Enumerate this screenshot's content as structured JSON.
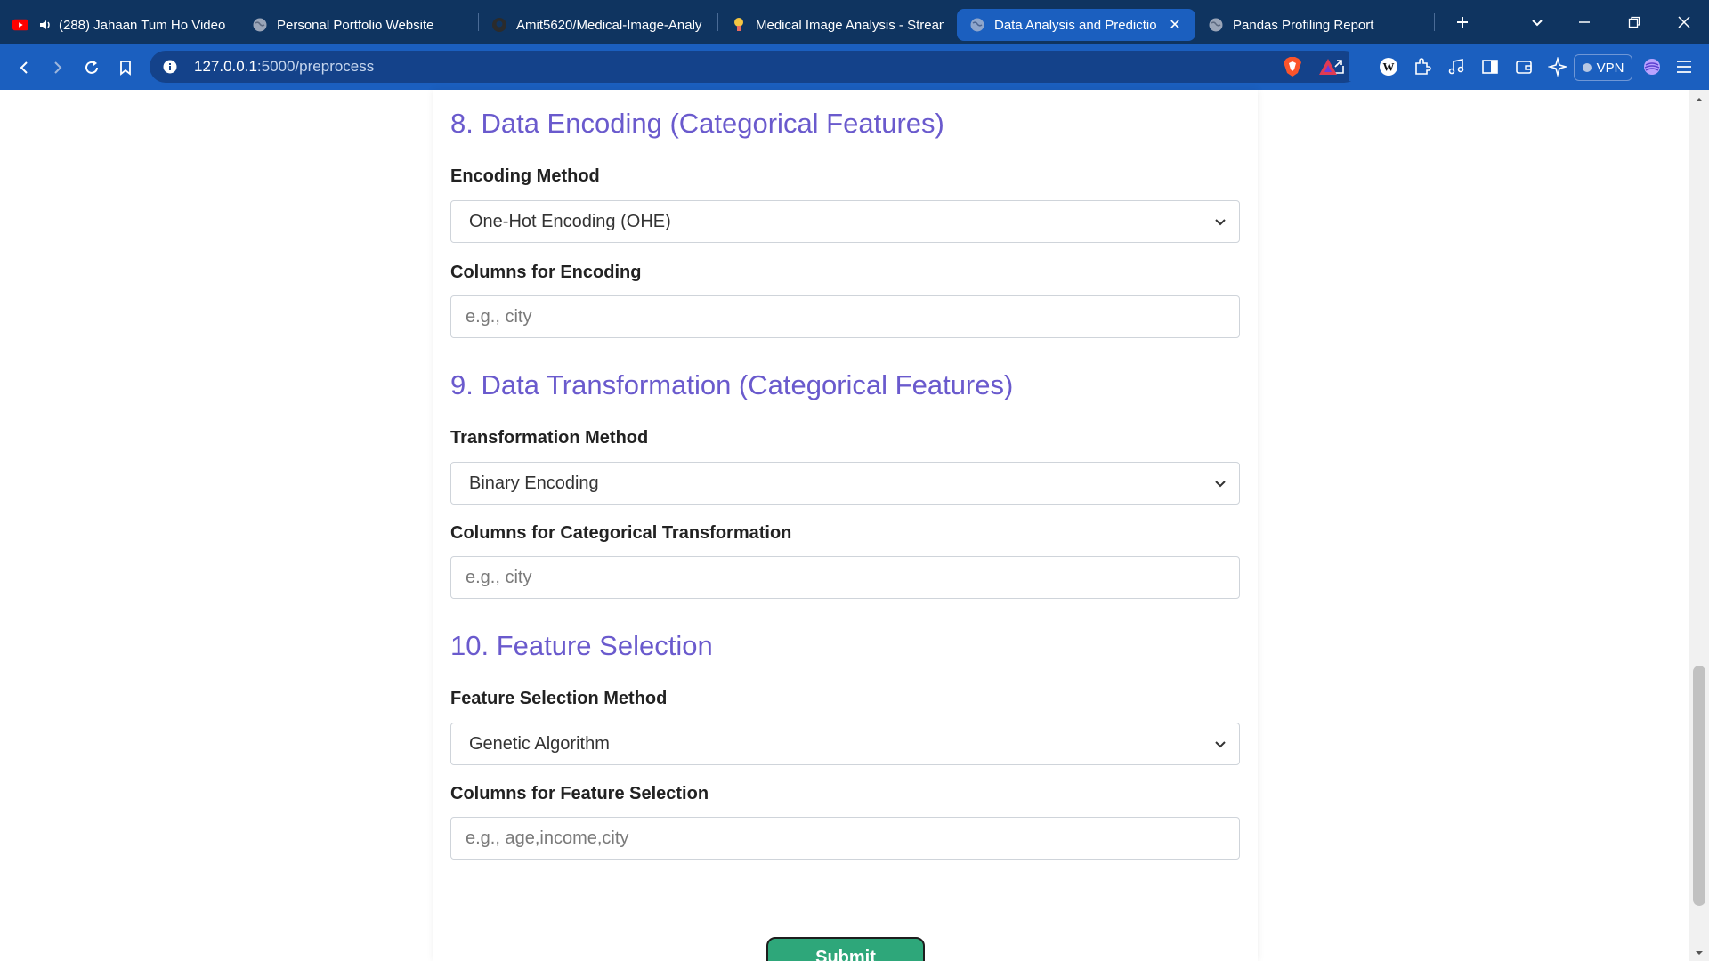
{
  "browser": {
    "tabs": [
      {
        "title": "(288) Jahaan Tum Ho Video",
        "icon": "youtube-icon",
        "active": false
      },
      {
        "title": "Personal Portfolio Website",
        "icon": "globe-icon",
        "active": false
      },
      {
        "title": "Amit5620/Medical-Image-Analy",
        "icon": "github-icon",
        "active": false
      },
      {
        "title": "Medical Image Analysis - Stream",
        "icon": "streamlit-icon",
        "active": false
      },
      {
        "title": "Data Analysis and Predictio",
        "icon": "globe-icon",
        "active": true
      },
      {
        "title": "Pandas Profiling Report",
        "icon": "globe-icon",
        "active": false
      }
    ],
    "url_host": "127.0.0.1",
    "url_path": ":5000/preprocess",
    "vpn_label": "VPN"
  },
  "form": {
    "section8": {
      "title": "8. Data Encoding (Categorical Features)",
      "method_label": "Encoding Method",
      "method_value": "One-Hot Encoding (OHE)",
      "columns_label": "Columns for Encoding",
      "columns_placeholder": "e.g., city"
    },
    "section9": {
      "title": "9. Data Transformation (Categorical Features)",
      "method_label": "Transformation Method",
      "method_value": "Binary Encoding",
      "columns_label": "Columns for Categorical Transformation",
      "columns_placeholder": "e.g., city"
    },
    "section10": {
      "title": "10. Feature Selection",
      "method_label": "Feature Selection Method",
      "method_value": "Genetic Algorithm",
      "columns_label": "Columns for Feature Selection",
      "columns_placeholder": "e.g., age,income,city"
    },
    "submit_label": "Submit"
  },
  "colors": {
    "section_title": "#6a5acd",
    "tabstrip": "#0f3460",
    "toolbar": "#1b5fbf",
    "submit": "#2ea77a"
  }
}
